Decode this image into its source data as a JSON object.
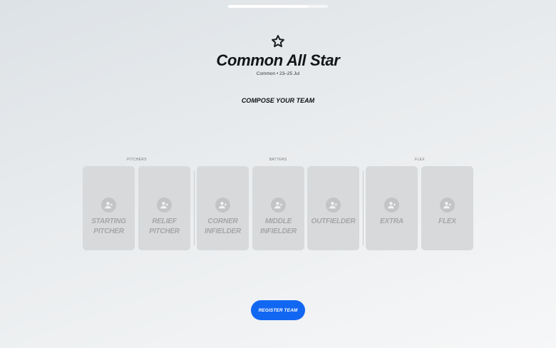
{
  "progress": {
    "fraction": 0.8
  },
  "header": {
    "icon": "star-icon",
    "title": "Common All Star",
    "subtitle": "Common • 23–25 Jul"
  },
  "section_heading": "COMPOSE YOUR TEAM",
  "groups": {
    "pitchers": "PITCHERS",
    "batters": "BATTERS",
    "flex": "FLEX"
  },
  "slots": [
    {
      "line1": "STARTING",
      "line2": "PITCHER",
      "icon": "add-player-icon"
    },
    {
      "line1": "RELIEF",
      "line2": "PITCHER",
      "icon": "add-player-icon"
    },
    {
      "line1": "CORNER",
      "line2": "INFIELDER",
      "icon": "add-player-icon"
    },
    {
      "line1": "MIDDLE",
      "line2": "INFIELDER",
      "icon": "add-player-icon"
    },
    {
      "line1": "OUTFIELDER",
      "line2": "",
      "icon": "add-player-icon"
    },
    {
      "line1": "EXTRA",
      "line2": "",
      "icon": "add-player-icon"
    },
    {
      "line1": "FLEX",
      "line2": "",
      "icon": "add-player-icon"
    }
  ],
  "register_button": "REGISTER TEAM",
  "colors": {
    "accent": "#1267f2",
    "slot_bg": "#d7d9db",
    "slot_text": "#a4a6a8"
  }
}
